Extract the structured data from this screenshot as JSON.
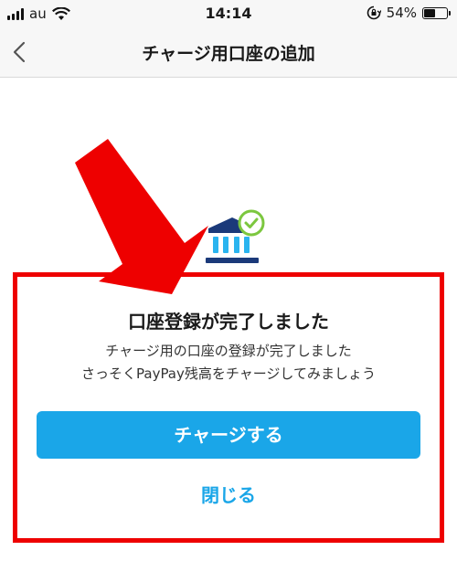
{
  "status_bar": {
    "carrier": "au",
    "time": "14:14",
    "battery": "54%",
    "battery_level": 0.54
  },
  "nav": {
    "title": "チャージ用口座の追加"
  },
  "dialog": {
    "title": "口座登録が完了しました",
    "message_line1": "チャージ用の口座の登録が完了しました",
    "message_line2": "さっそくPayPay残高をチャージしてみましょう",
    "primary_button": "チャージする",
    "close_link": "閉じる"
  },
  "colors": {
    "accent": "#1aa6e8",
    "bank_icon_dark": "#1b3a7a",
    "bank_icon_light": "#2ab4ef",
    "check_green": "#7cc73f",
    "annotation_red": "#ee0000"
  },
  "icons": [
    "signal-icon",
    "wifi-icon",
    "orientation-lock-icon",
    "battery-icon",
    "back-chevron-icon",
    "bank-icon",
    "check-badge-icon"
  ]
}
